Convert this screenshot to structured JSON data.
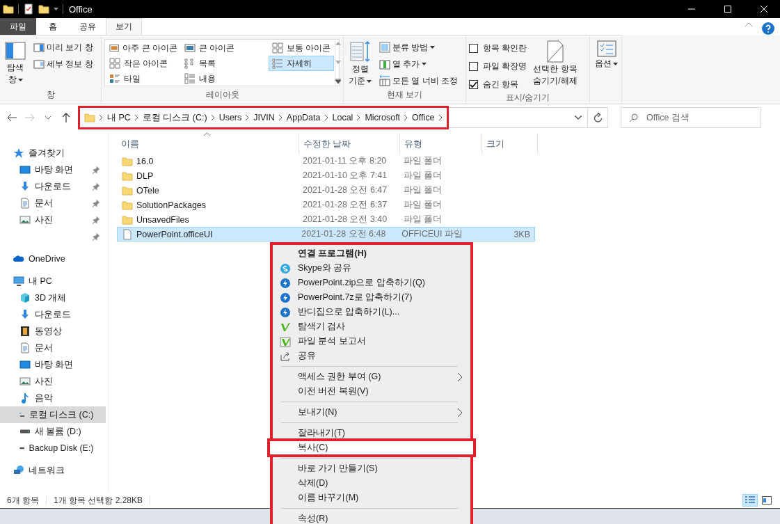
{
  "window": {
    "title": "Office"
  },
  "ribbon": {
    "tabs": [
      {
        "label": "파일",
        "kind": "file",
        "selected": false
      },
      {
        "label": "홈",
        "kind": "tab",
        "selected": false
      },
      {
        "label": "공유",
        "kind": "tab",
        "selected": false
      },
      {
        "label": "보기",
        "kind": "tab",
        "selected": true
      }
    ],
    "groups": [
      {
        "kind": "pane",
        "label": "창",
        "big": {
          "lines": [
            "탐색",
            "창"
          ],
          "dropdown": true
        },
        "items": [
          {
            "label": "미리 보기 창",
            "kind": "preview"
          },
          {
            "label": "세부 정보 창",
            "kind": "details"
          }
        ]
      },
      {
        "kind": "layout",
        "label": "레이아웃",
        "items": [
          {
            "label": "아주 큰 아이콘",
            "kind": "xl",
            "selected": false
          },
          {
            "label": "큰 아이콘",
            "kind": "large",
            "selected": false
          },
          {
            "label": "보통 아이콘",
            "kind": "medium",
            "selected": false
          },
          {
            "label": "작은 아이콘",
            "kind": "small",
            "selected": false
          },
          {
            "label": "목록",
            "kind": "list",
            "selected": false
          },
          {
            "label": "자세히",
            "kind": "details",
            "selected": true
          },
          {
            "label": "타일",
            "kind": "tiles",
            "selected": false
          },
          {
            "label": "내용",
            "kind": "content",
            "selected": false
          }
        ]
      },
      {
        "kind": "view",
        "label": "현재 보기",
        "big": {
          "lines": [
            "정렬",
            "기준"
          ],
          "dropdown": true
        },
        "items": [
          {
            "label": "분류 방법",
            "kind": "group",
            "dropdown": true
          },
          {
            "label": "열 추가",
            "kind": "columns",
            "dropdown": true
          },
          {
            "label": "모든 열 너비 조정",
            "kind": "fit",
            "dropdown": false
          }
        ]
      },
      {
        "kind": "showhide",
        "label": "표시/숨기기",
        "checks": [
          {
            "label": "항목 확인란",
            "checked": false
          },
          {
            "label": "파일 확장명",
            "checked": false
          },
          {
            "label": "숨긴 항목",
            "checked": true
          }
        ],
        "big": {
          "lines": [
            "선택한 항목",
            "숨기기/해제"
          ],
          "dropdown": false
        }
      },
      {
        "kind": "options",
        "big": {
          "lines": [
            "옵션"
          ],
          "dropdown": true
        }
      }
    ]
  },
  "address": {
    "highlighted": true,
    "segments": [
      "내 PC",
      "로컬 디스크 (C:)",
      "Users",
      "JIVIN",
      "AppData",
      "Local",
      "Microsoft",
      "Office"
    ]
  },
  "search": {
    "placeholder": "Office 검색"
  },
  "sidebar": [
    {
      "label": "즐겨찾기",
      "kind": "star",
      "children": [
        {
          "label": "바탕 화면",
          "kind": "desktop",
          "pinned": true,
          "selected": false
        },
        {
          "label": "다운로드",
          "kind": "download",
          "pinned": true,
          "selected": false
        },
        {
          "label": "문서",
          "kind": "document",
          "pinned": true,
          "selected": false
        },
        {
          "label": "사진",
          "kind": "picture",
          "pinned": true,
          "selected": false
        },
        {
          "kind": "blank",
          "pinned": true,
          "selected": false
        }
      ]
    },
    {
      "label": "OneDrive",
      "kind": "cloud"
    },
    {
      "label": "내 PC",
      "kind": "computer",
      "children": [
        {
          "label": "3D 개체",
          "kind": "cube",
          "pinned": false,
          "selected": false
        },
        {
          "label": "다운로드",
          "kind": "download",
          "pinned": false,
          "selected": false
        },
        {
          "label": "동영상",
          "kind": "film",
          "pinned": false,
          "selected": false
        },
        {
          "label": "문서",
          "kind": "document",
          "pinned": false,
          "selected": false
        },
        {
          "label": "바탕 화면",
          "kind": "desktop",
          "pinned": false,
          "selected": false
        },
        {
          "label": "사진",
          "kind": "picture",
          "pinned": false,
          "selected": false
        },
        {
          "label": "음악",
          "kind": "music",
          "pinned": false,
          "selected": false
        },
        {
          "label": "로컬 디스크 (C:)",
          "kind": "sysdrive",
          "pinned": false,
          "selected": true
        },
        {
          "label": "새 볼륨 (D:)",
          "kind": "drive",
          "pinned": false,
          "selected": false
        },
        {
          "label": "Backup Disk (E:)",
          "kind": "drive",
          "pinned": false,
          "selected": false
        }
      ]
    },
    {
      "label": "네트워크",
      "kind": "network"
    }
  ],
  "table": {
    "columns": [
      "이름",
      "수정한 날짜",
      "유형",
      "크기"
    ],
    "rows": [
      {
        "name": "16.0",
        "date": "2021-01-11 오후 8:20",
        "type": "파일 폴더",
        "kind": "folder",
        "selected": false
      },
      {
        "name": "DLP",
        "date": "2021-01-10 오후 7:41",
        "type": "파일 폴더",
        "kind": "folder",
        "selected": false
      },
      {
        "name": "OTele",
        "date": "2021-01-28 오전 6:47",
        "type": "파일 폴더",
        "kind": "folder",
        "selected": false
      },
      {
        "name": "SolutionPackages",
        "date": "2021-01-28 오전 6:37",
        "type": "파일 폴더",
        "kind": "folder",
        "selected": false
      },
      {
        "name": "UnsavedFiles",
        "date": "2021-01-28 오전 3:40",
        "type": "파일 폴더",
        "kind": "folder",
        "selected": false
      },
      {
        "name": "PowerPoint.officeUI",
        "date": "2021-01-28 오전 6:48",
        "type": "OFFICEUI 파일",
        "size": "3KB",
        "kind": "file",
        "selected": true
      }
    ]
  },
  "context_menu": {
    "highlighted": true,
    "items": [
      {
        "kind": "plain",
        "label": "연결 프로그램(H)",
        "default": true,
        "submenu": false,
        "highlighted": false
      },
      {
        "kind": "skype",
        "label": "Skype와 공유",
        "default": false,
        "submenu": false,
        "highlighted": false
      },
      {
        "kind": "zip",
        "label": "PowerPoint.zip으로 압축하기(Q)",
        "default": false,
        "submenu": false,
        "highlighted": false
      },
      {
        "kind": "zip",
        "label": "PowerPoint.7z로 압축하기(7)",
        "default": false,
        "submenu": false,
        "highlighted": false
      },
      {
        "kind": "zip",
        "label": "반디집으로 압축하기(L)...",
        "default": false,
        "submenu": false,
        "highlighted": false
      },
      {
        "kind": "scan",
        "label": "탐색기 검사",
        "default": false,
        "submenu": false,
        "highlighted": false
      },
      {
        "kind": "report",
        "label": "파일 분석 보고서",
        "default": false,
        "submenu": false,
        "highlighted": false
      },
      {
        "kind": "share",
        "label": "공유",
        "default": false,
        "submenu": false,
        "highlighted": false
      },
      {
        "kind": "separator"
      },
      {
        "kind": "plain",
        "label": "액세스 권한 부여 (G)",
        "default": false,
        "submenu": true,
        "highlighted": false
      },
      {
        "kind": "plain",
        "label": "이전 버전 복원(V)",
        "default": false,
        "submenu": false,
        "highlighted": false
      },
      {
        "kind": "separator"
      },
      {
        "kind": "plain",
        "label": "보내기(N)",
        "default": false,
        "submenu": true,
        "highlighted": false
      },
      {
        "kind": "separator"
      },
      {
        "kind": "plain",
        "label": "잘라내기(T)",
        "default": false,
        "submenu": false,
        "highlighted": false
      },
      {
        "kind": "plain",
        "label": "복사(C)",
        "default": false,
        "submenu": false,
        "highlighted": true
      },
      {
        "kind": "separator"
      },
      {
        "kind": "plain",
        "label": "바로 가기 만들기(S)",
        "default": false,
        "submenu": false,
        "highlighted": false
      },
      {
        "kind": "plain",
        "label": "삭제(D)",
        "default": false,
        "submenu": false,
        "highlighted": false
      },
      {
        "kind": "plain",
        "label": "이름 바꾸기(M)",
        "default": false,
        "submenu": false,
        "highlighted": false
      },
      {
        "kind": "separator"
      },
      {
        "kind": "plain",
        "label": "속성(R)",
        "default": false,
        "submenu": false,
        "highlighted": false
      }
    ]
  },
  "status_bar": {
    "count": "6개 항목",
    "selection": "1개 항목 선택함 2.28KB",
    "views": [
      {
        "kind": "details",
        "selected": true
      },
      {
        "kind": "tiles",
        "selected": false
      }
    ]
  }
}
